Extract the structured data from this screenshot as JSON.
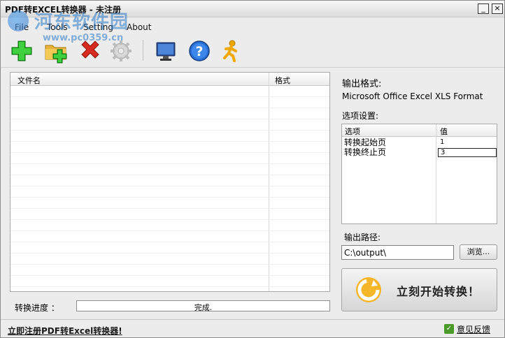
{
  "window": {
    "title": "PDF转EXCEL转换器 - 未注册",
    "minimize_glyph": "_",
    "close_glyph": "×"
  },
  "watermark": {
    "text": "河东软件园",
    "url": "www.pc0359.cn"
  },
  "menu": [
    {
      "label": "File"
    },
    {
      "label": "Tools"
    },
    {
      "label": "Setting"
    },
    {
      "label": "About"
    }
  ],
  "toolbar": {
    "icons": [
      "add-file-icon",
      "add-folder-icon",
      "delete-icon",
      "settings-icon",
      "monitor-icon",
      "help-icon",
      "run-person-icon"
    ],
    "colors": {
      "add": "#1aa61a",
      "folder": "#e8b23a",
      "delete": "#d62a1e",
      "help": "#2a6fd6",
      "person": "#f0a800"
    }
  },
  "file_list": {
    "columns": [
      "文件名",
      "格式"
    ],
    "rows": []
  },
  "progress": {
    "label": "转换进度 ：",
    "status": "完成.",
    "value": 0
  },
  "output": {
    "format_title": "输出格式:",
    "format_value": "Microsoft Office Excel XLS Format",
    "options_title": "选项设置:",
    "options_columns": [
      "选项",
      "值"
    ],
    "options": [
      {
        "name": "转换起始页",
        "value": "1"
      },
      {
        "name": "转换终止页",
        "value": "3"
      }
    ],
    "path_title": "输出路径:",
    "path_value": "C:\\output\\",
    "browse_label": "浏览...",
    "start_label": "立刻开始转换！"
  },
  "statusbar": {
    "register_link": "立即注册PDF转Excel转换器!",
    "feedback": "意见反馈"
  }
}
